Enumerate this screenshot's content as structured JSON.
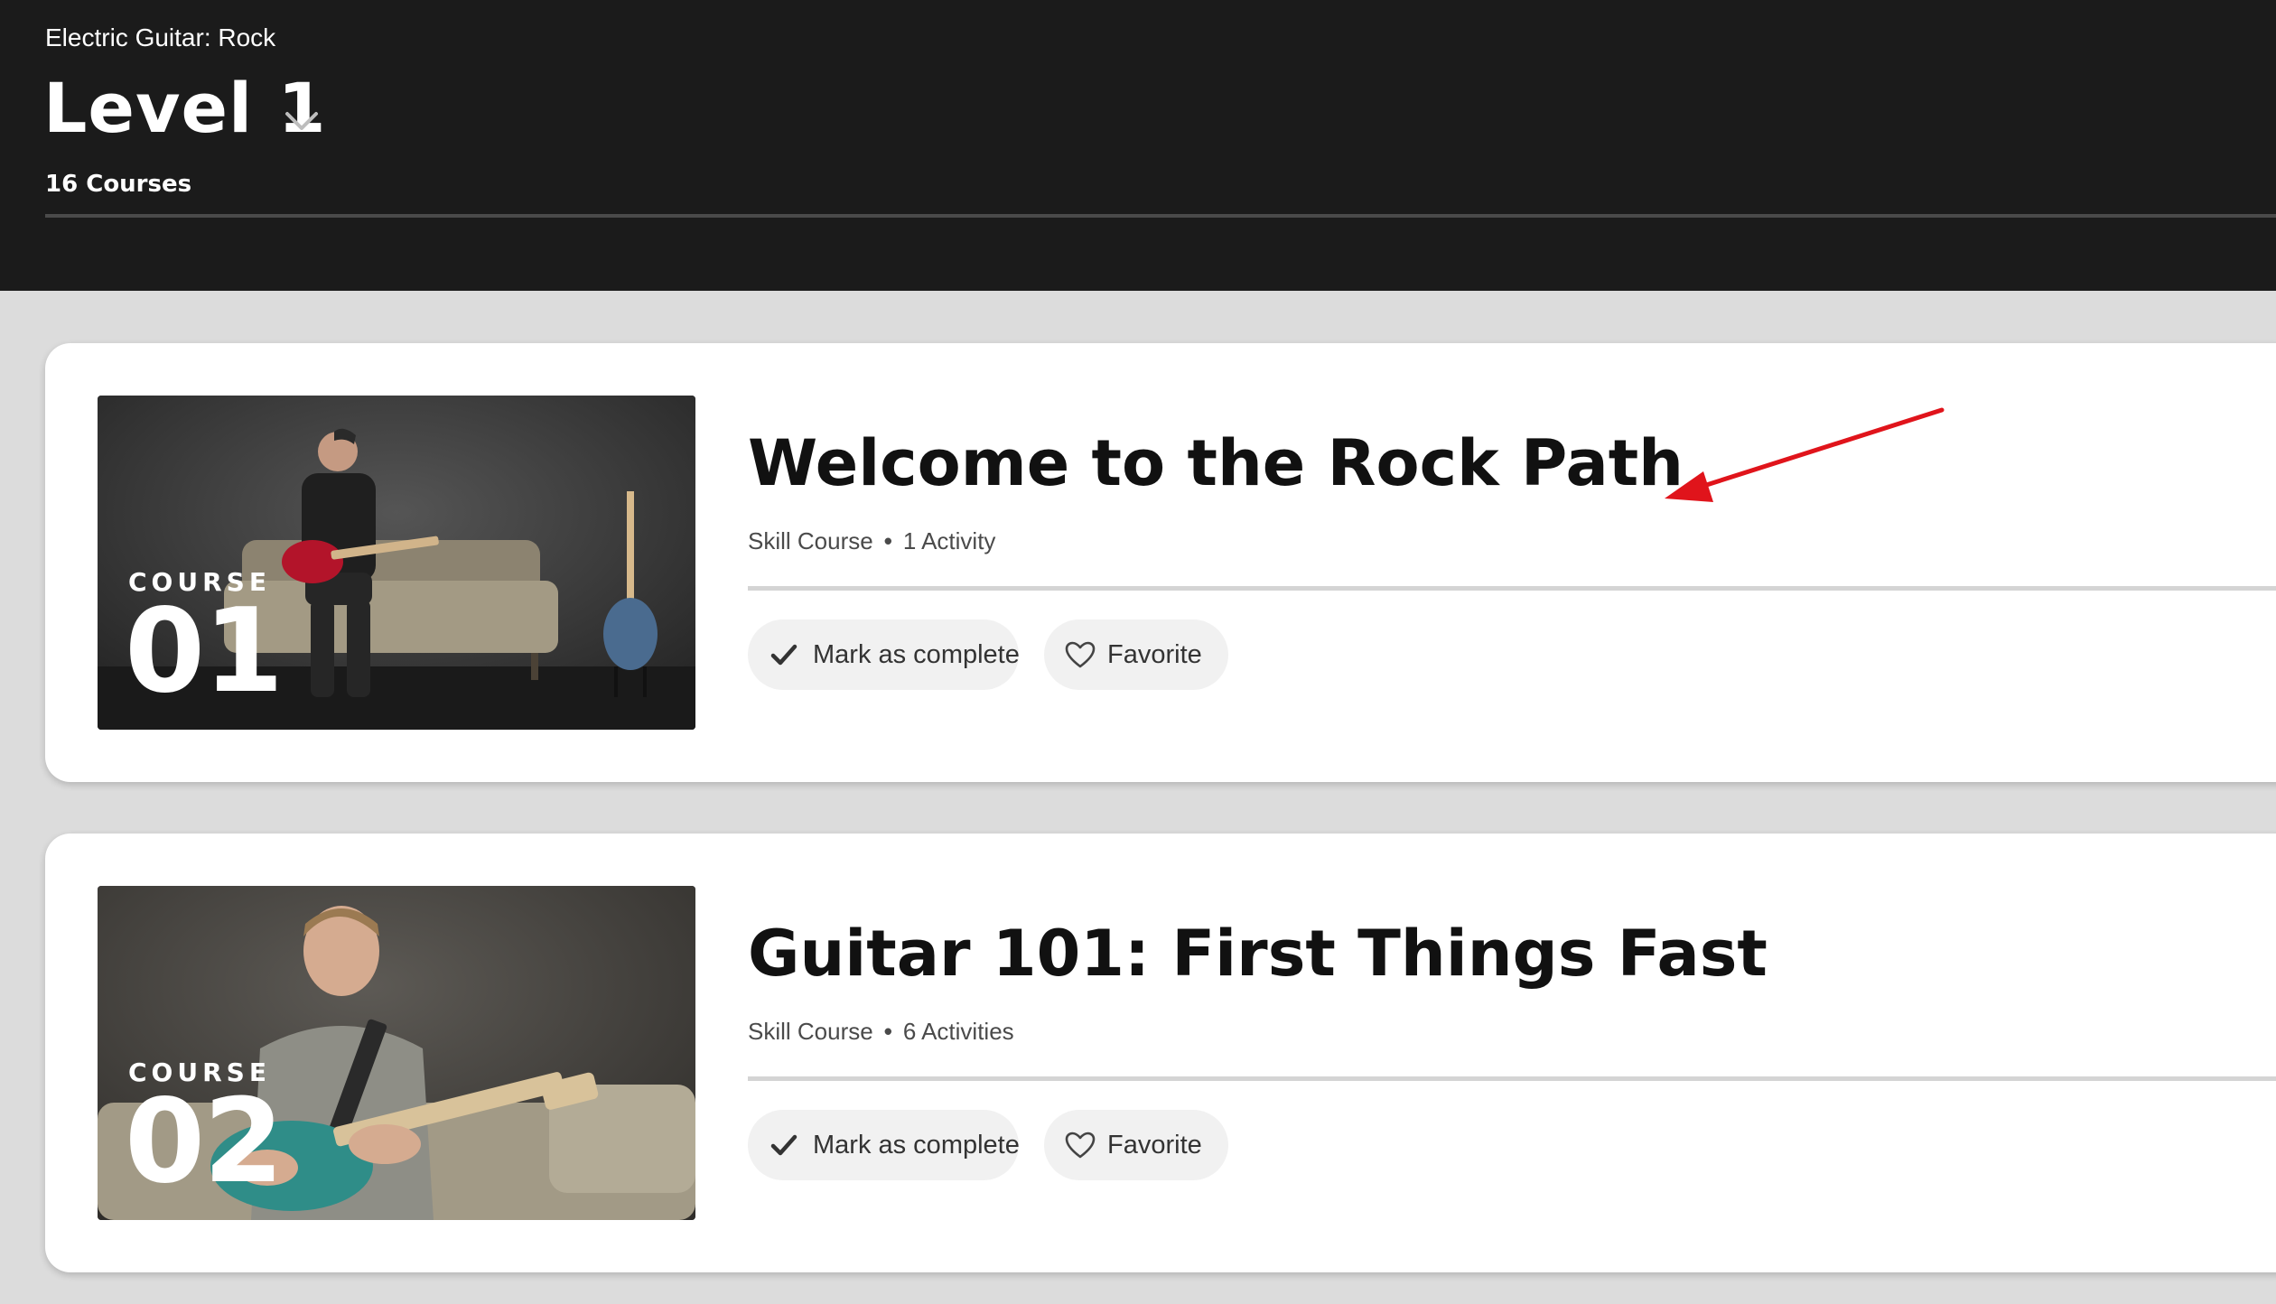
{
  "header": {
    "path_name": "Electric Guitar: Rock",
    "level_title": "Level 1",
    "course_count": "16 Courses"
  },
  "courses": [
    {
      "course_label": "COURSE",
      "number": "01",
      "title": "Welcome to the Rock Path",
      "type": "Skill Course",
      "activities": "1 Activity",
      "progress": 0,
      "complete_label": "Mark as complete",
      "favorite_label": "Favorite"
    },
    {
      "course_label": "COURSE",
      "number": "02",
      "title": "Guitar 101: First Things Fast",
      "type": "Skill Course",
      "activities": "6 Activities",
      "progress": 0,
      "complete_label": "Mark as complete",
      "favorite_label": "Favorite"
    }
  ],
  "icons": {
    "level_dropdown": "chevron-down-icon",
    "complete": "checkmark-icon",
    "favorite": "heart-icon",
    "annotation": "red-arrow-annotation"
  },
  "colors": {
    "header_bg": "#1b1b1b",
    "page_bg": "#dcdcdc",
    "card_bg": "#ffffff",
    "annotation_arrow": "#e0141b"
  }
}
